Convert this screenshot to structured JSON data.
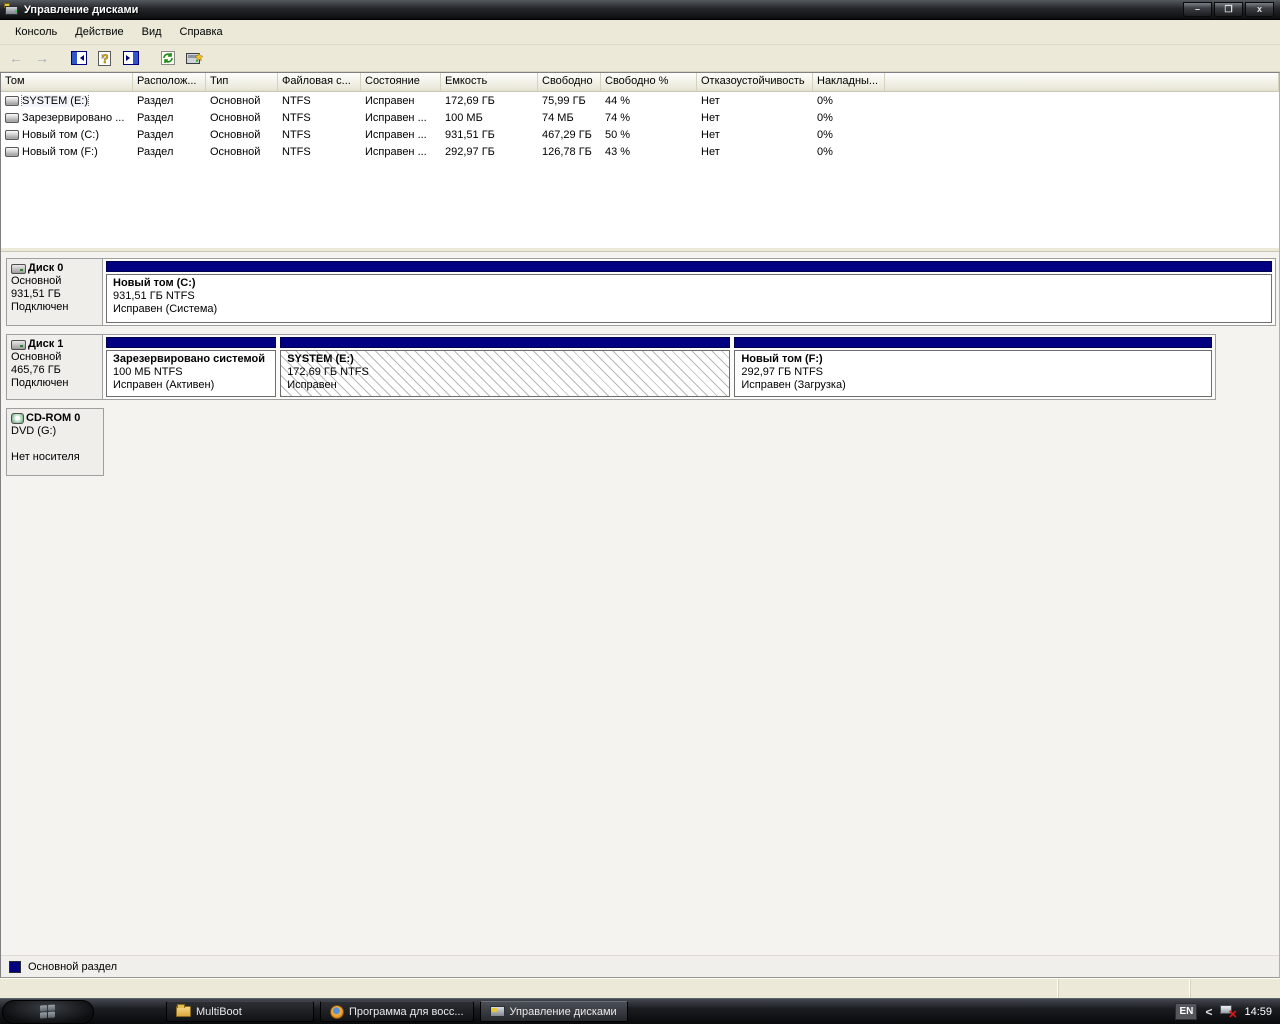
{
  "window": {
    "title": "Управление дисками",
    "controls": {
      "minimize": "–",
      "restore": "❐",
      "close": "x"
    }
  },
  "menu": {
    "items": [
      {
        "label": "Консоль"
      },
      {
        "label": "Действие"
      },
      {
        "label": "Вид"
      },
      {
        "label": "Справка"
      }
    ]
  },
  "toolbar": {
    "icons": [
      "back",
      "forward",
      "show-console-tree",
      "help",
      "show-action-pane",
      "refresh",
      "rescan-disks"
    ]
  },
  "volume_table": {
    "columns": [
      "Том",
      "Располож...",
      "Тип",
      "Файловая с...",
      "Состояние",
      "Емкость",
      "Свободно",
      "Свободно %",
      "Отказоустойчивость",
      "Накладны..."
    ],
    "rows": [
      [
        "SYSTEM (E:)",
        "Раздел",
        "Основной",
        "NTFS",
        "Исправен",
        "172,69 ГБ",
        "75,99 ГБ",
        "44 %",
        "Нет",
        "0%"
      ],
      [
        "Зарезервировано ...",
        "Раздел",
        "Основной",
        "NTFS",
        "Исправен ...",
        "100 МБ",
        "74 МБ",
        "74 %",
        "Нет",
        "0%"
      ],
      [
        "Новый том (C:)",
        "Раздел",
        "Основной",
        "NTFS",
        "Исправен ...",
        "931,51 ГБ",
        "467,29 ГБ",
        "50 %",
        "Нет",
        "0%"
      ],
      [
        "Новый том (F:)",
        "Раздел",
        "Основной",
        "NTFS",
        "Исправен ...",
        "292,97 ГБ",
        "126,78 ГБ",
        "43 %",
        "Нет",
        "0%"
      ]
    ]
  },
  "disks": [
    {
      "name": "Диск 0",
      "type": "Основной",
      "size": "931,51 ГБ",
      "status": "Подключен",
      "partitions": [
        {
          "name": "Новый том  (C:)",
          "size": "931,51 ГБ NTFS",
          "status": "Исправен (Система)",
          "selected": false
        }
      ]
    },
    {
      "name": "Диск 1",
      "type": "Основной",
      "size": "465,76 ГБ",
      "status": "Подключен",
      "partitions": [
        {
          "name": "Зарезервировано системой",
          "size": "100 МБ NTFS",
          "status": "Исправен (Активен)",
          "selected": false
        },
        {
          "name": "SYSTEM  (E:)",
          "size": "172,69 ГБ NTFS",
          "status": "Исправен",
          "selected": true
        },
        {
          "name": "Новый том  (F:)",
          "size": "292,97 ГБ NTFS",
          "status": "Исправен (Загрузка)",
          "selected": false
        }
      ]
    },
    {
      "name": "CD-ROM 0",
      "media": "DVD (G:)",
      "status": "Нет носителя"
    }
  ],
  "legend": {
    "label": "Основной раздел",
    "color": "#000080"
  },
  "taskbar": {
    "tasks": [
      {
        "label": "MultiBoot",
        "active": false
      },
      {
        "label": "Программа для восс...",
        "active": false
      },
      {
        "label": "Управление дисками",
        "active": true
      }
    ],
    "tray": {
      "language": "EN",
      "chevron": "<",
      "time": "14:59"
    }
  },
  "colors": {
    "primary_partition": "#000080",
    "titlebar": "#1b1d20",
    "chrome_bg": "#ece9d8"
  }
}
